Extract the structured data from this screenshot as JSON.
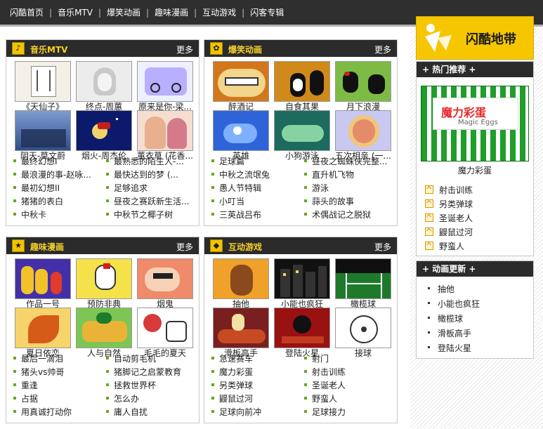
{
  "topnav": {
    "items": [
      "闪酷首页",
      "音乐MTV",
      "爆笑动画",
      "趣味漫画",
      "互动游戏",
      "闪客专辑"
    ],
    "separator": "|"
  },
  "panels": [
    {
      "title": "音乐MTV",
      "more": "更多",
      "icon": "music-note-icon",
      "thumbs": [
        "《天仙子》",
        "终点-周蕙",
        "原来是你-梁...",
        "阴天-莫文蔚",
        "烟火-周杰伦",
        "董衣草 (花香..."
      ],
      "links": [
        "最终幻想I",
        "最熟悉的陌生人-...",
        "最浪漫的事-赵咏...",
        "最快达到的梦 (...",
        "最初幻想II",
        "足够追求",
        "猪猪的表白",
        "昼夜之赛跃新生活...",
        "中秋卡",
        "中秋节之椰子树"
      ]
    },
    {
      "title": "爆笑动画",
      "more": "更多",
      "icon": "sprout-icon",
      "thumbs": [
        "醉酒记",
        "自食其果",
        "月下浪漫",
        "英雄",
        "小狗游泳",
        "五次相亲 (一..."
      ],
      "links": [
        "足球篇",
        "昼夜之蜘蛛侠完整...",
        "中秋之流氓兔",
        "直升机飞物",
        "愚人节特辑",
        "游泳",
        "小叮当",
        "蒜头的故事",
        "三英战吕布",
        "术偶战记之脱狱"
      ]
    },
    {
      "title": "趣味漫画",
      "more": "更多",
      "icon": "star-icon",
      "thumbs": [
        "作品一号",
        "预防非典",
        "烟鬼",
        "夏日依恋",
        "人与自然",
        "毛毛的夏天"
      ],
      "links": [
        "最后一滴泪",
        "自动剪毛机",
        "猪头vs帅哥",
        "猪脚记之启蒙教育",
        "重逢",
        "拯救世界杯",
        "占据",
        "怎么办",
        "用真诚打动你",
        "庸人自扰"
      ]
    },
    {
      "title": "互动游戏",
      "more": "更多",
      "icon": "game-icon",
      "thumbs": [
        "抽他",
        "小能也疯狂",
        "橄榄球",
        "滑板高手",
        "登陆火星",
        "接球"
      ],
      "links": [
        "急速赛车",
        "射门",
        "魔力彩蛋",
        "射击训练",
        "另类弹球",
        "圣诞老人",
        "鼹鼠过河",
        "野蛮人",
        "足球向前冲",
        "足球接力"
      ]
    }
  ],
  "sidebar": {
    "logo_text": "闪酷地带",
    "hot": {
      "title": "+ 热门推荐 +",
      "feature_text": "魔力彩蛋",
      "feature_sub": "Magic Eggs",
      "feature_caption": "魔力彩蛋",
      "items": [
        "射击训练",
        "另类弹球",
        "圣诞老人",
        "鼹鼠过河",
        "野蛮人"
      ]
    },
    "updates": {
      "title": "+ 动画更新 +",
      "items": [
        "抽他",
        "小能也疯狂",
        "橄榄球",
        "滑板高手",
        "登陆火星"
      ]
    }
  },
  "colors": {
    "header_bg": "#2b2b2b",
    "panel_title": "#f4d02a",
    "link_bullet": "#6aa523",
    "logo_bg": "#f6c700",
    "feature_green": "#1f9e2a"
  }
}
